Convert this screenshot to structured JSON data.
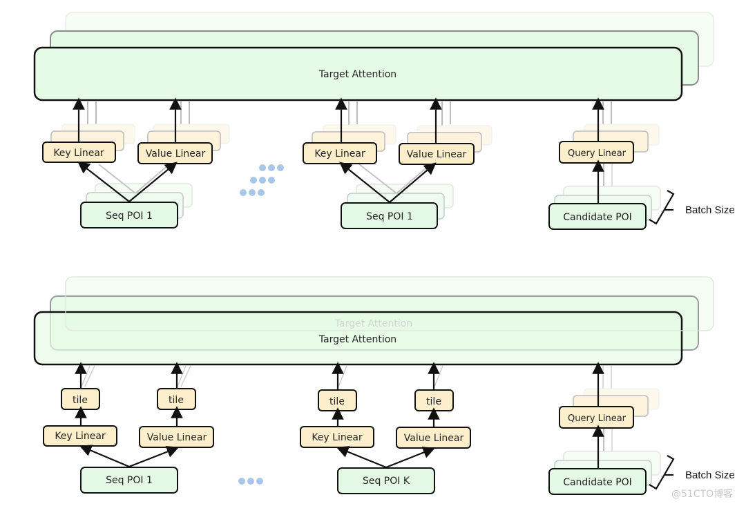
{
  "colors": {
    "attention_fill": "#e6fbe6",
    "linear_fill": "#fdefcc",
    "poi_fill": "#e4f8e6",
    "ellipsis_dot": "#a9c7ea",
    "stroke": "#111111"
  },
  "top_diagram": {
    "attention_label": "Target Attention",
    "groups": [
      {
        "key_label": "Key Linear",
        "value_label": "Value Linear",
        "seq_label": "Seq POI 1"
      },
      {
        "key_label": "Key Linear",
        "value_label": "Value Linear",
        "seq_label": "Seq POI 1"
      }
    ],
    "query_label": "Query Linear",
    "candidate_label": "Candidate POI",
    "batch_label": "Batch Size"
  },
  "bottom_diagram": {
    "attention_label": "Target Attention",
    "attention_shadow_label": "Target Attention",
    "groups": [
      {
        "tile_k": "tile",
        "tile_v": "tile",
        "key_label": "Key Linear",
        "value_label": "Value Linear",
        "seq_label": "Seq POI 1"
      },
      {
        "tile_k": "tile",
        "tile_v": "tile",
        "key_label": "Key Linear",
        "value_label": "Value Linear",
        "seq_label": "Seq POI K"
      }
    ],
    "query_label": "Query Linear",
    "candidate_label": "Candidate POI",
    "batch_label": "Batch Size"
  },
  "watermark": "@51CTO博客"
}
